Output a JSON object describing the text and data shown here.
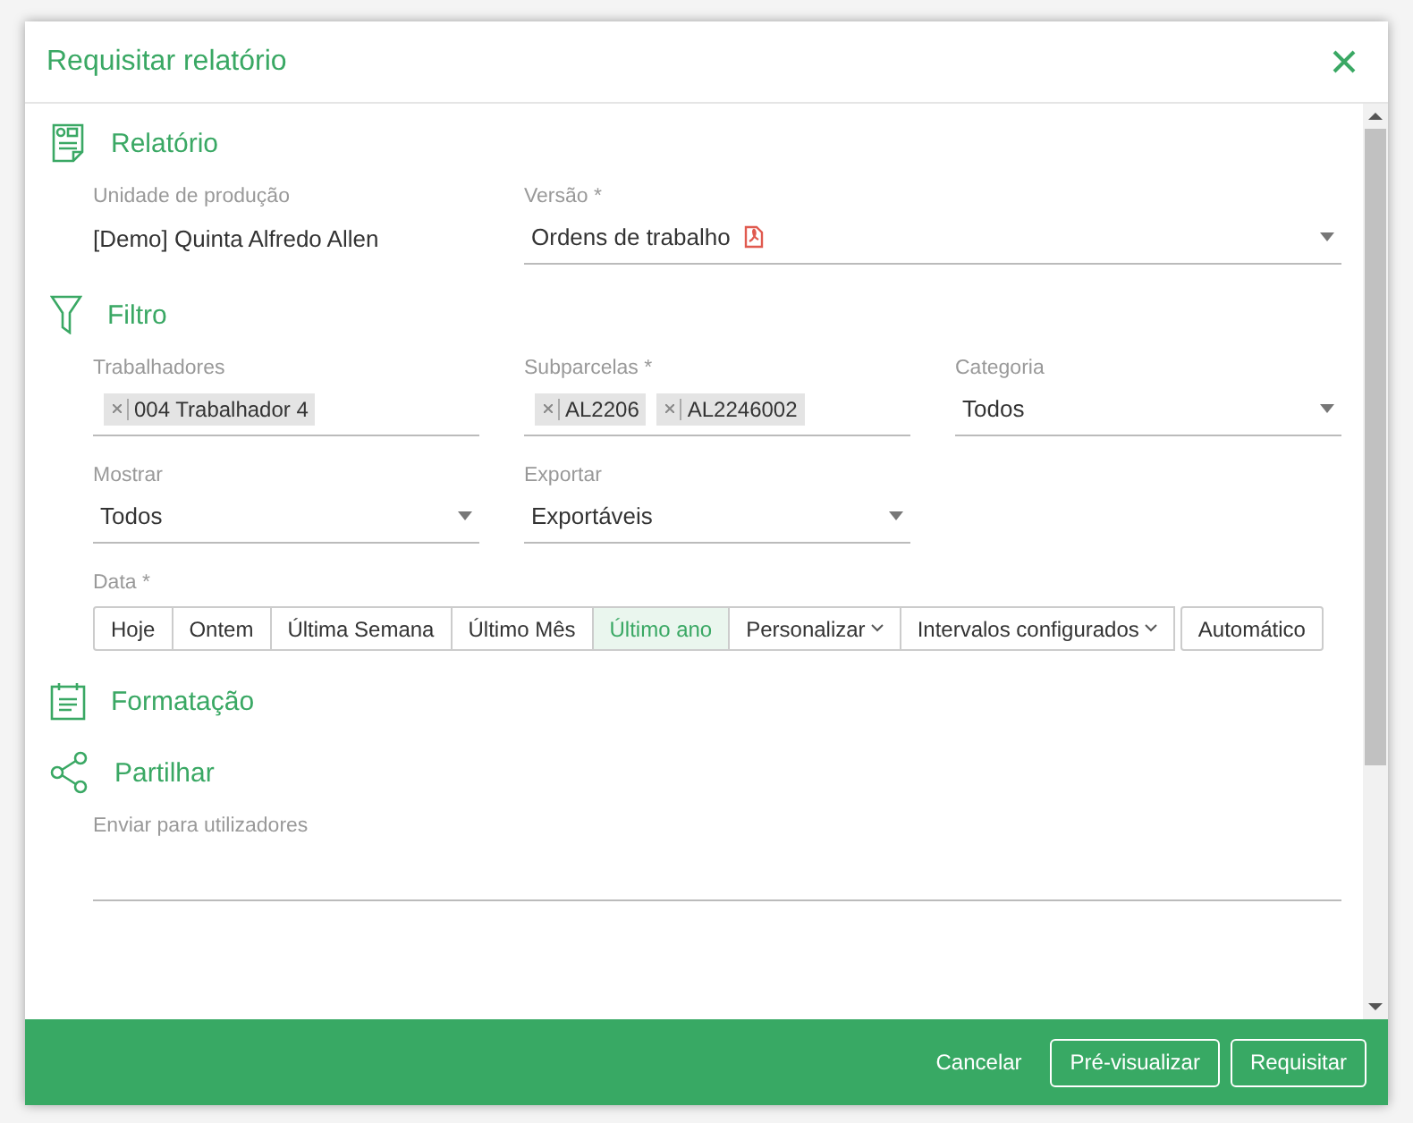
{
  "dialog": {
    "title": "Requisitar relatório"
  },
  "sections": [
    {
      "title": "Relatório",
      "fields": [
        {
          "kind": "static",
          "label": "Unidade de produção",
          "value": "[Demo] Quinta Alfredo Allen"
        },
        {
          "kind": "select",
          "label": "Versão *",
          "value": "Ordens de trabalho",
          "pdf": true
        }
      ]
    },
    {
      "title": "Filtro",
      "fields": [
        {
          "kind": "tags",
          "label": "Trabalhadores",
          "tags": [
            "004 Trabalhador 4"
          ]
        },
        {
          "kind": "tags",
          "label": "Subparcelas *",
          "tags": [
            "AL2206",
            "AL2246002"
          ]
        },
        {
          "kind": "select",
          "label": "Categoria",
          "value": "Todos"
        },
        {
          "kind": "select",
          "label": "Mostrar",
          "value": "Todos"
        },
        {
          "kind": "select",
          "label": "Exportar",
          "value": "Exportáveis"
        },
        {
          "kind": "buttons",
          "label": "Data *",
          "buttons": [
            {
              "label": "Hoje",
              "selected": false,
              "dropdown": false
            },
            {
              "label": "Ontem",
              "selected": false,
              "dropdown": false
            },
            {
              "label": "Última Semana",
              "selected": false,
              "dropdown": false
            },
            {
              "label": "Último Mês",
              "selected": false,
              "dropdown": false
            },
            {
              "label": "Último ano",
              "selected": true,
              "dropdown": false
            },
            {
              "label": "Personalizar",
              "selected": false,
              "dropdown": true
            },
            {
              "label": "Intervalos configurados",
              "selected": false,
              "dropdown": true
            }
          ],
          "extra_button": "Automático"
        }
      ]
    },
    {
      "title": "Formatação"
    },
    {
      "title": "Partilhar",
      "fields": [
        {
          "kind": "input",
          "label": "Enviar para utilizadores"
        }
      ]
    }
  ],
  "footer": {
    "buttons": [
      {
        "label": "Cancelar",
        "kind": "text"
      },
      {
        "label": "Pré-visualizar",
        "kind": "outline"
      },
      {
        "label": "Requisitar",
        "kind": "outline"
      }
    ]
  }
}
